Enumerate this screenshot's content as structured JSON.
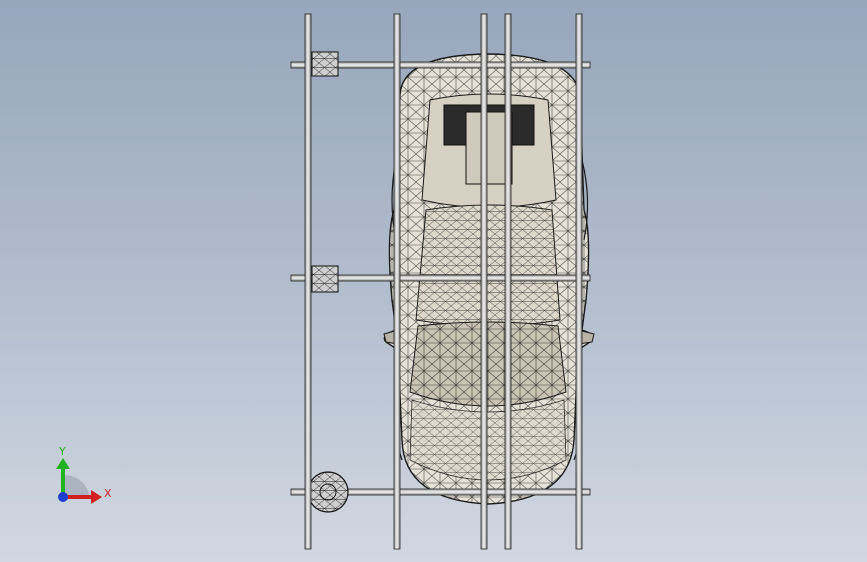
{
  "viewport": {
    "background_top": "#97a6bc",
    "background_bottom": "#d2d8e2"
  },
  "model": {
    "wire_color": "#1a1a1a",
    "body_fill": "#e6e2d8",
    "glass_fill": "#c9c4b4",
    "pole_fill": "#d9d9d9",
    "pole_edge": "#222222"
  },
  "triad": {
    "x_label": "X",
    "y_label": "Y",
    "x_color": "#d21f1f",
    "y_color": "#1fb31f",
    "origin_color": "#1f3fd2"
  }
}
